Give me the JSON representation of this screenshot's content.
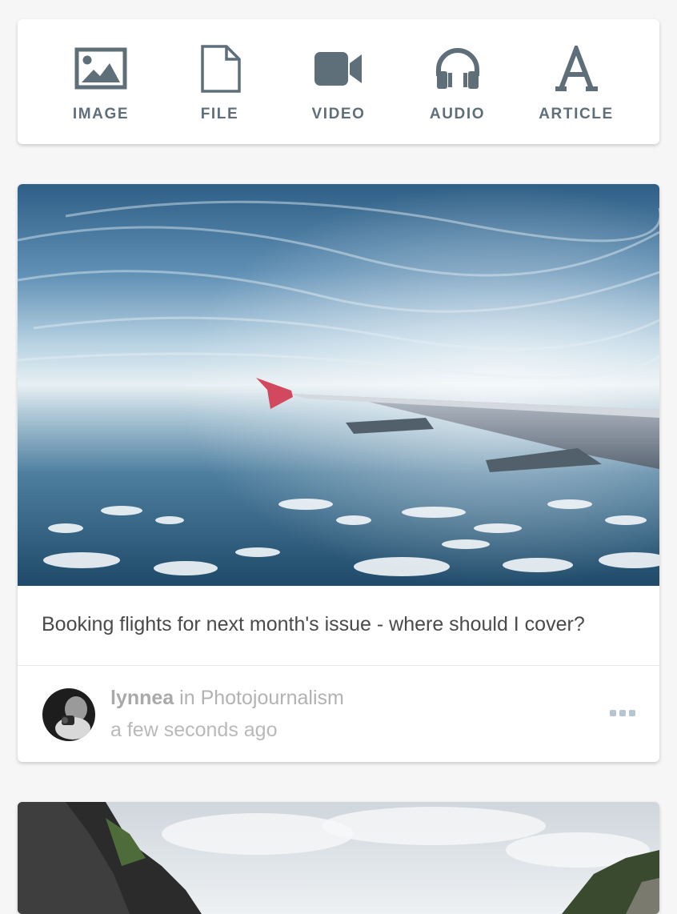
{
  "post_types": [
    {
      "label": "IMAGE",
      "icon": "image-icon"
    },
    {
      "label": "FILE",
      "icon": "file-icon"
    },
    {
      "label": "VIDEO",
      "icon": "video-icon"
    },
    {
      "label": "AUDIO",
      "icon": "headphones-icon"
    },
    {
      "label": "ARTICLE",
      "icon": "article-icon"
    }
  ],
  "posts": [
    {
      "caption": "Booking flights for next month's issue - where should I cover?",
      "author": "lynnea",
      "in_text": "in",
      "community": "Photojournalism",
      "time": "a few seconds ago"
    }
  ],
  "colors": {
    "icon": "#5f6f7a",
    "accent_more": "#b7c4d2",
    "background": "#f6f6f6"
  }
}
